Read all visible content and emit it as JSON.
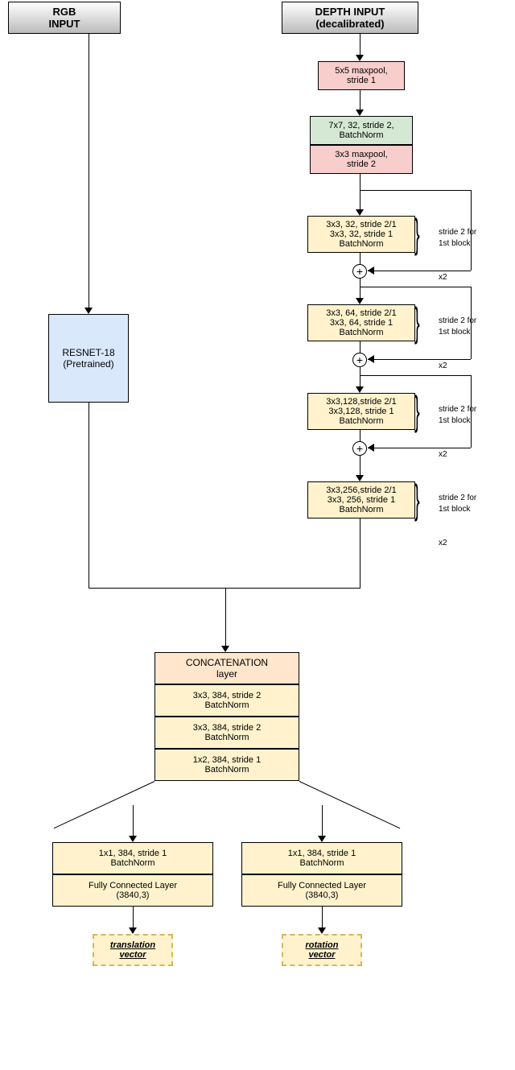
{
  "inputs": {
    "rgb": "RGB\nINPUT",
    "depth": "DEPTH INPUT\n(decalibrated)"
  },
  "resnet": "RESNET-18\n(Pretrained)",
  "depth_stream": {
    "pool1": "5x5 maxpool,\nstride 1",
    "conv1": "7x7, 32, stride 2,\nBatchNorm",
    "pool2": "3x3 maxpool,\nstride 2",
    "block1": {
      "l1": "3x3, 32, stride 2/1",
      "l2": "3x3, 32, stride 1",
      "l3": "BatchNorm"
    },
    "block2": {
      "l1": "3x3, 64, stride 2/1",
      "l2": "3x3, 64, stride 1",
      "l3": "BatchNorm"
    },
    "block3": {
      "l1": "3x3,128,stride 2/1",
      "l2": "3x3,128, stride 1",
      "l3": "BatchNorm"
    },
    "block4": {
      "l1": "3x3,256,stride 2/1",
      "l2": "3x3, 256, stride 1",
      "l3": "BatchNorm"
    },
    "note_stride": "stride 2 for\n1st block",
    "note_x2": "x2"
  },
  "concat": {
    "header": "CONCATENATION\nlayer",
    "c1": "3x3, 384, stride 2\nBatchNorm",
    "c2": "3x3, 384, stride 2\nBatchNorm",
    "c3": "1x2, 384, stride 1\nBatchNorm"
  },
  "output_branch": {
    "conv": "1x1, 384, stride 1\nBatchNorm",
    "fc": "Fully Connected Layer\n(3840,3)"
  },
  "outputs": {
    "translation": "translation\nvector",
    "rotation": "rotation\nvector"
  }
}
